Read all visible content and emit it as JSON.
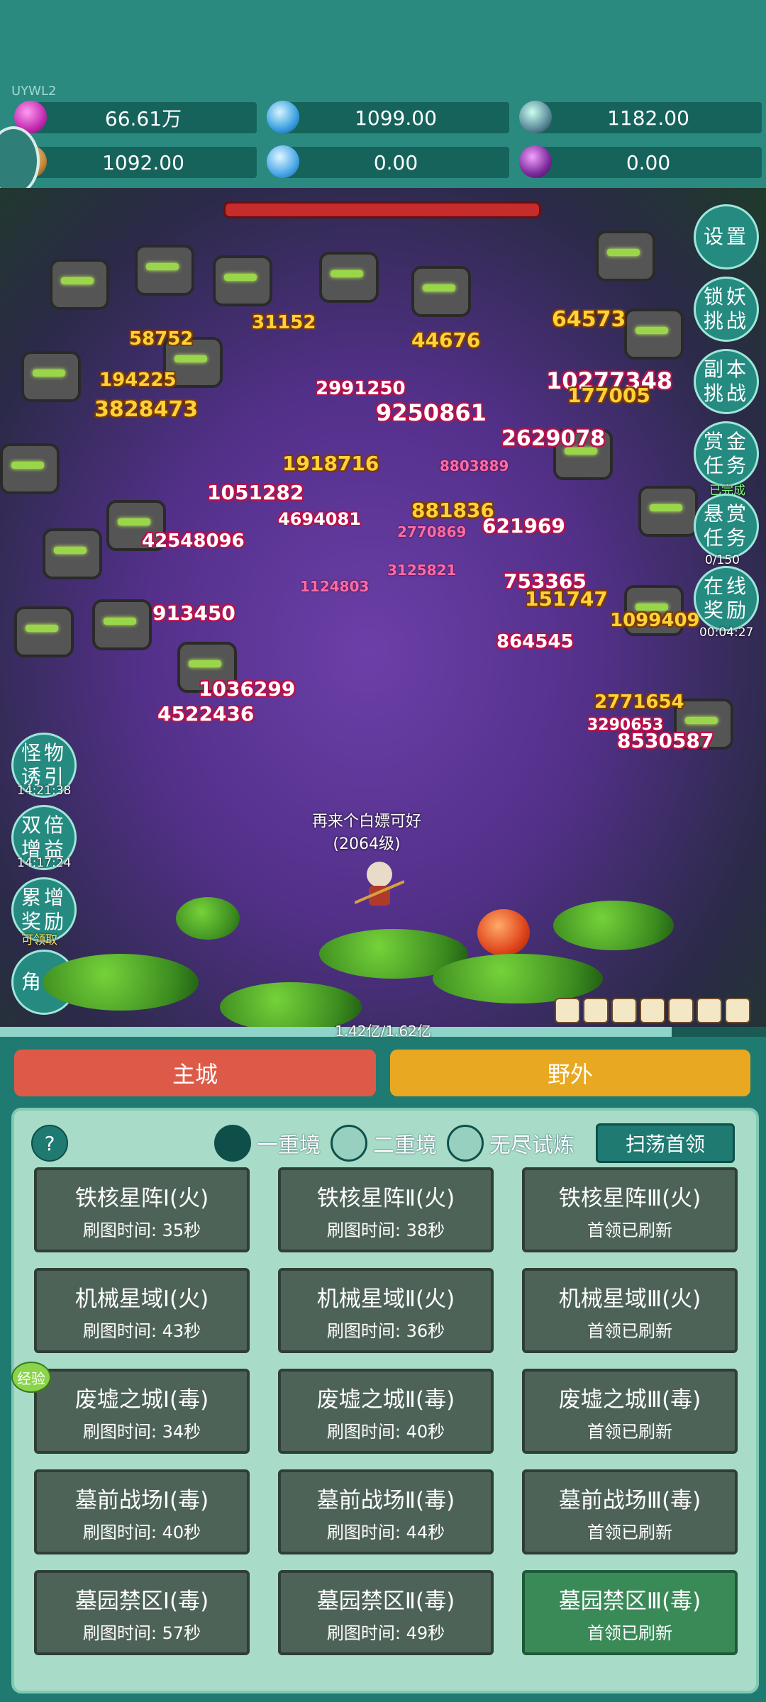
{
  "hud": {
    "uid": "UYWL2",
    "resources": [
      {
        "icon": "gem-icon",
        "value": "66.61万"
      },
      {
        "icon": "ice-crystal-icon",
        "value": "1099.00"
      },
      {
        "icon": "stone-orb-icon",
        "value": "1182.00"
      },
      {
        "icon": "shell-icon",
        "value": "1092.00"
      },
      {
        "icon": "blue-crystal-icon",
        "value": "0.00"
      },
      {
        "icon": "purple-pot-icon",
        "value": "0.00"
      }
    ]
  },
  "right_buttons": [
    {
      "l1": "设置",
      "l2": "",
      "sub": ""
    },
    {
      "l1": "锁妖",
      "l2": "挑战",
      "sub": ""
    },
    {
      "l1": "副本",
      "l2": "挑战",
      "sub": ""
    },
    {
      "l1": "赏金",
      "l2": "任务",
      "sub": "已完成"
    },
    {
      "l1": "悬赏",
      "l2": "任务",
      "sub": "0/150"
    },
    {
      "l1": "在线",
      "l2": "奖励",
      "sub": "00:04:27"
    }
  ],
  "left_buttons": [
    {
      "l1": "怪物",
      "l2": "诱引",
      "sub": "14:21:38"
    },
    {
      "l1": "双倍",
      "l2": "增益",
      "sub": "14:17:24"
    },
    {
      "l1": "累增",
      "l2": "奖励",
      "sub": "可领取"
    },
    {
      "l1": "角色",
      "l2": "",
      "sub": ""
    }
  ],
  "damage_numbers": [
    "31152",
    "58752",
    "64573",
    "44676",
    "194225",
    "3828473",
    "2991250",
    "10277348",
    "9250861",
    "2629078",
    "177005",
    "1918716",
    "1051282",
    "881836",
    "621969",
    "42548096",
    "4694081",
    "913450",
    "1036299",
    "4522436",
    "864545",
    "753365",
    "151747",
    "1099409",
    "2771654",
    "8530587",
    "3290653",
    "1124803",
    "3125821",
    "2770869",
    "8803889"
  ],
  "player": {
    "name": "再来个白嫖可好",
    "level": "(2064级)"
  },
  "hp_text": "1.42亿/1.62亿",
  "hp_fraction": 0.877,
  "tabs": {
    "main_city": "主城",
    "wild": "野外"
  },
  "panel": {
    "help": "?",
    "modes": [
      "一重境",
      "二重境",
      "无尽试炼"
    ],
    "sweep": "扫荡首领",
    "xp_badge": "经验",
    "stages": [
      {
        "name": "铁核星阵Ⅰ(火)",
        "sub": "刷图时间: 35秒"
      },
      {
        "name": "铁核星阵Ⅱ(火)",
        "sub": "刷图时间: 38秒"
      },
      {
        "name": "铁核星阵Ⅲ(火)",
        "sub": "首领已刷新"
      },
      {
        "name": "机械星域Ⅰ(火)",
        "sub": "刷图时间: 43秒"
      },
      {
        "name": "机械星域Ⅱ(火)",
        "sub": "刷图时间: 36秒"
      },
      {
        "name": "机械星域Ⅲ(火)",
        "sub": "首领已刷新"
      },
      {
        "name": "废墟之城Ⅰ(毒)",
        "sub": "刷图时间: 34秒"
      },
      {
        "name": "废墟之城Ⅱ(毒)",
        "sub": "刷图时间: 40秒"
      },
      {
        "name": "废墟之城Ⅲ(毒)",
        "sub": "首领已刷新"
      },
      {
        "name": "墓前战场Ⅰ(毒)",
        "sub": "刷图时间: 40秒"
      },
      {
        "name": "墓前战场Ⅱ(毒)",
        "sub": "刷图时间: 44秒"
      },
      {
        "name": "墓前战场Ⅲ(毒)",
        "sub": "首领已刷新"
      },
      {
        "name": "墓园禁区Ⅰ(毒)",
        "sub": "刷图时间: 57秒"
      },
      {
        "name": "墓园禁区Ⅱ(毒)",
        "sub": "刷图时间: 49秒"
      },
      {
        "name": "墓园禁区Ⅲ(毒)",
        "sub": "首领已刷新"
      }
    ]
  },
  "colors": {
    "main_city": "#de5a48",
    "wild": "#e8a822",
    "accent": "#1f7a72"
  }
}
